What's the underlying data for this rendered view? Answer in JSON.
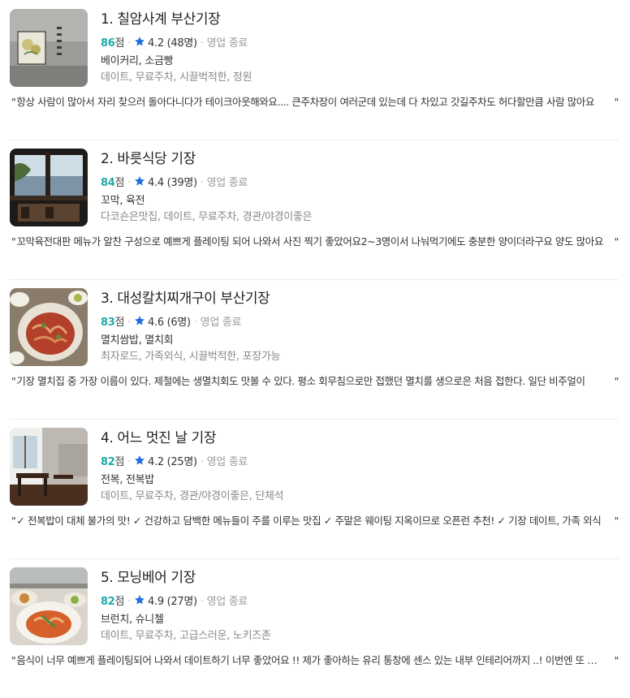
{
  "colors": {
    "score": "#24a8a8",
    "star": "#1f6fe0",
    "muted": "#888888"
  },
  "icons": {
    "rating": "star-icon"
  },
  "restaurants": [
    {
      "title": "1. 칠암사계 부산기장",
      "score": "86",
      "score_unit": "점",
      "rating": "4.2 (48명)",
      "status": "영업 종료",
      "categories": "베이커리, 소금빵",
      "tags": "데이트, 무료주차, 시끌벅적한, 정원",
      "review": "항상 사람이 많아서 자리 찾으러 돌아다니다가 테이크아웃해와요.... 큰주차장이 여러군데 있는데 다 차있고 갓길주차도 허다할만큼 사람 많아요"
    },
    {
      "title": "2. 바릇식당 기장",
      "score": "84",
      "score_unit": "점",
      "rating": "4.4 (39명)",
      "status": "영업 종료",
      "categories": "꼬막, 육전",
      "tags": "다코숀은맛집, 데이트, 무료주차, 경관/야경이좋은",
      "review": "꼬막육전대판 메뉴가 알찬 구성으로 예쁘게 플레이팅 되어 나와서 사진 찍기 좋았어요2~3명이서 나눠먹기에도 충분한 양이더라구요 양도 많아요"
    },
    {
      "title": "3. 대성칼치찌개구이 부산기장",
      "score": "83",
      "score_unit": "점",
      "rating": "4.6 (6명)",
      "status": "영업 종료",
      "categories": "멸치쌈밥, 멸치회",
      "tags": "최자로드, 가족외식, 시끌벅적한, 포장가능",
      "review": "기장 멸치집 중 가장 이름이 있다. 제철에는 생멸치회도 맛볼 수 있다. 평소 회무침으로만 접했던 멸치를 생으로은 처음 접한다. 일단 비주얼이"
    },
    {
      "title": "4. 어느 멋진 날 기장",
      "score": "82",
      "score_unit": "점",
      "rating": "4.2 (25명)",
      "status": "영업 종료",
      "categories": "전복, 전복밥",
      "tags": "데이트, 무료주차, 경관/야경이좋은, 단체석",
      "review": "✓ 전복밥이 대체 불가의 맛! ✓ 건강하고 담백한 메뉴들이 주를 이루는 맛집 ✓ 주말은 웨이팅 지옥이므로 오픈런 추천! ✓ 기장 데이트, 가족 외식"
    },
    {
      "title": "5. 모닝베어 기장",
      "score": "82",
      "score_unit": "점",
      "rating": "4.9 (27명)",
      "status": "영업 종료",
      "categories": "브런치, 슈니첼",
      "tags": "데이트, 무료주차, 고급스러운, 노키즈존",
      "review": "음식이 너무 예쁘게 플레이팅되어 나와서 데이트하기 너무 좋았어요 !! 제가 좋아하는 유리 통창에 센스 있는 내부 인테리어까지 ..! 이번엔 또 가요"
    }
  ]
}
